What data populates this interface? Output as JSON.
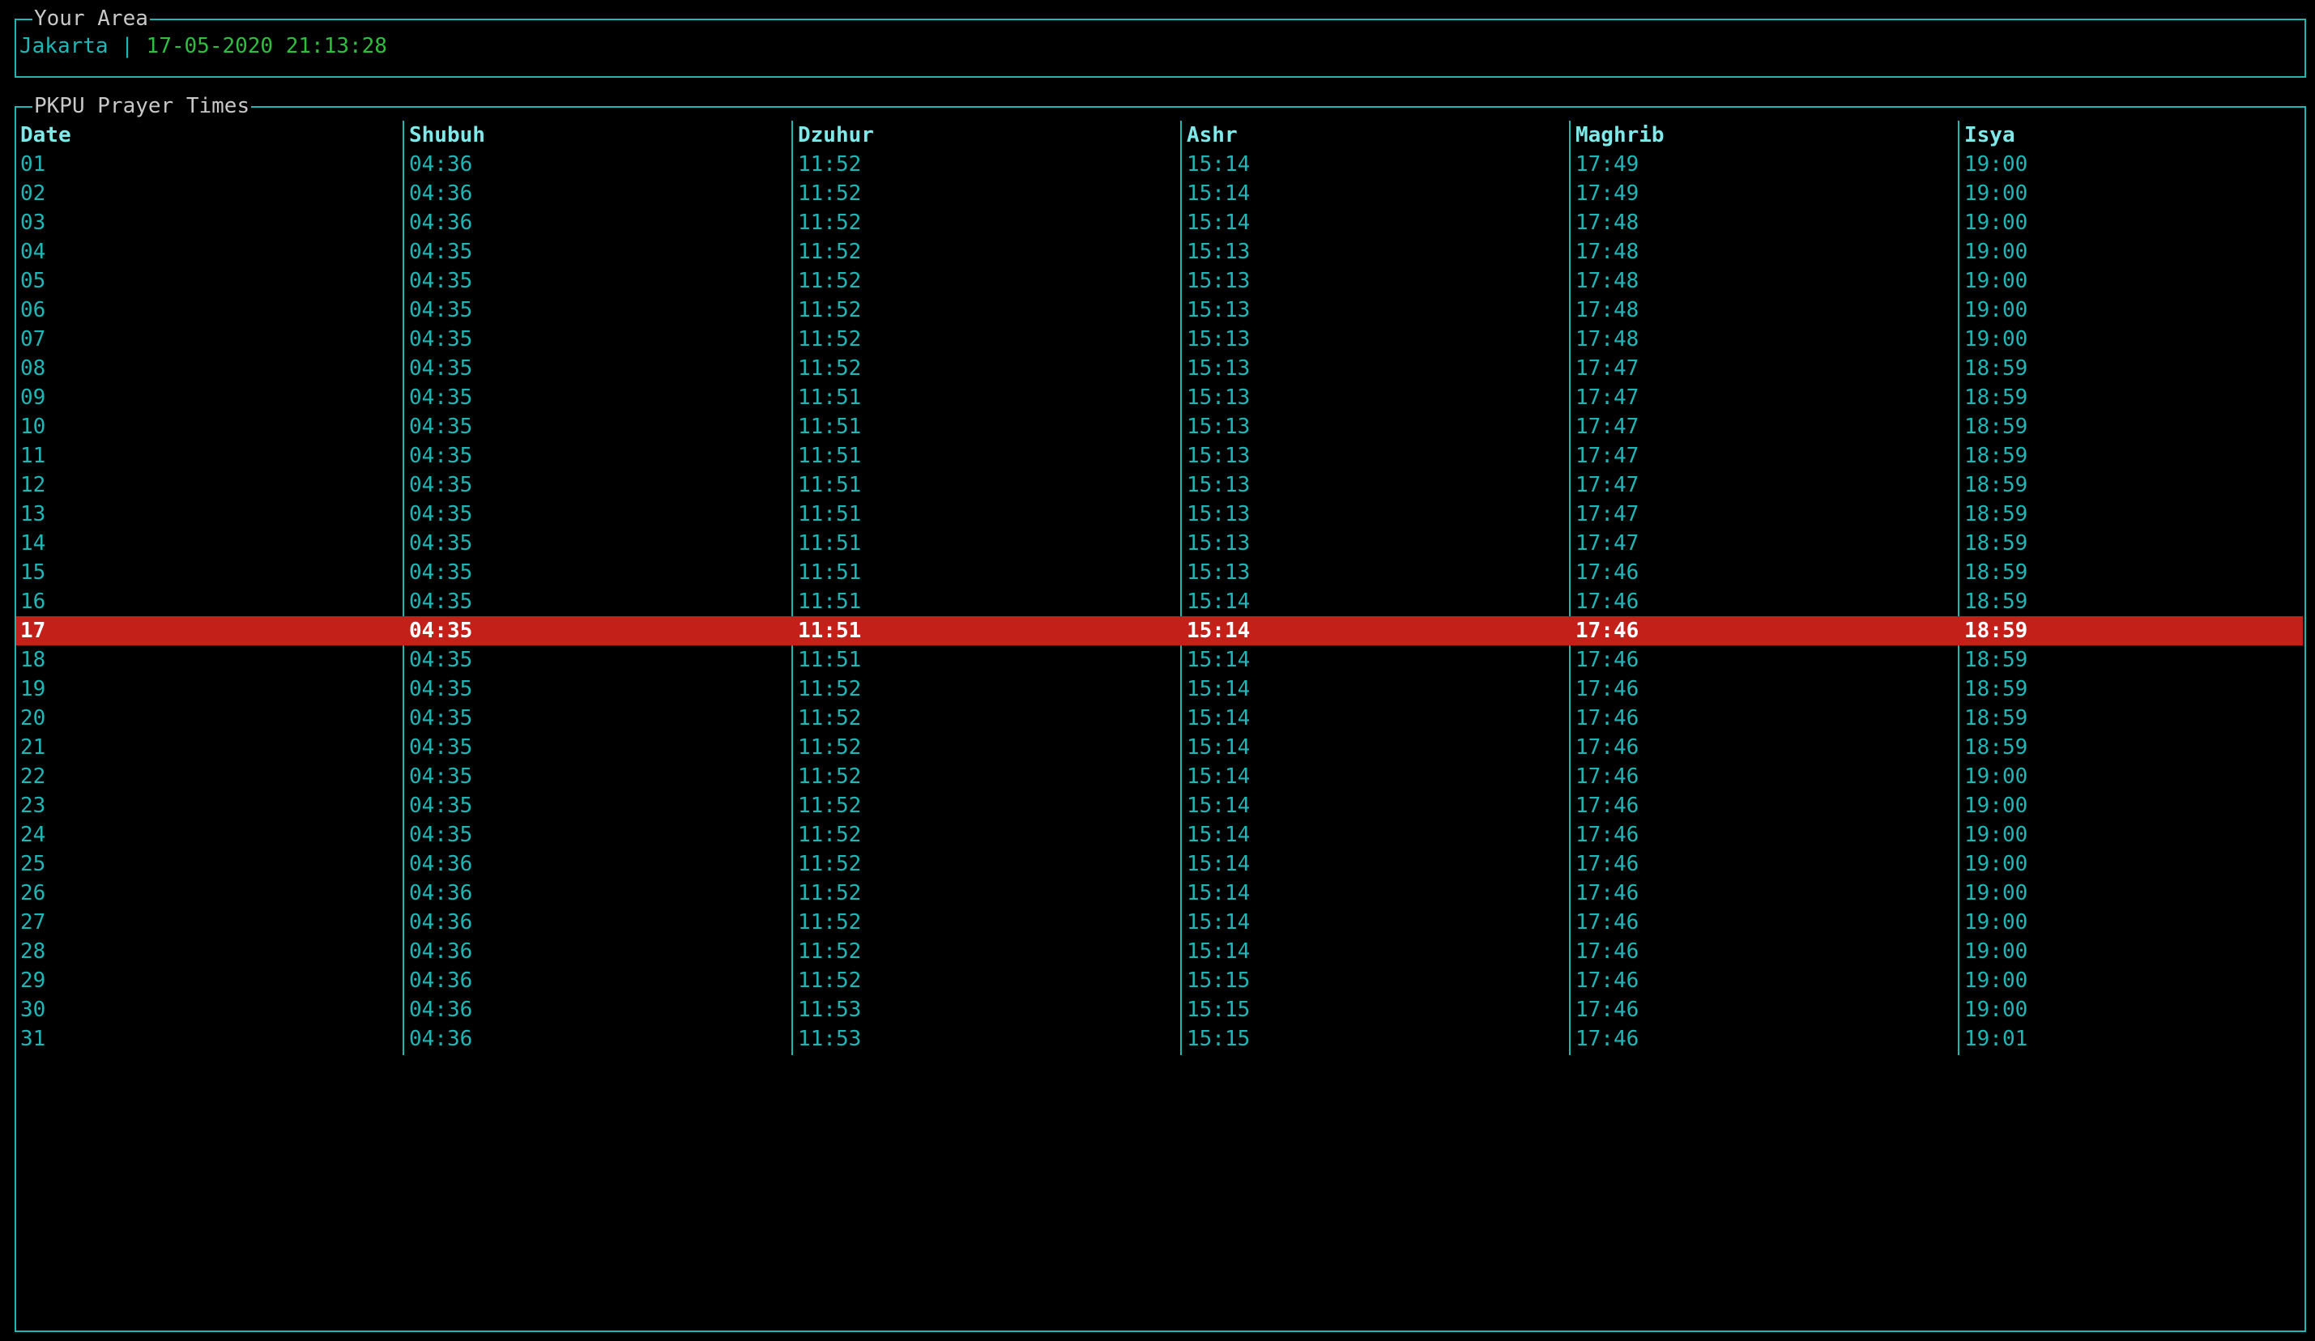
{
  "area_panel": {
    "title": "Your Area",
    "city": "Jakarta",
    "separator": " | ",
    "datetime": "17-05-2020 21:13:28"
  },
  "prayer_panel": {
    "title": "PKPU Prayer Times",
    "columns": [
      "Date",
      "Shubuh",
      "Dzuhur",
      "Ashr",
      "Maghrib",
      "Isya"
    ],
    "highlighted_date": "17",
    "colors": {
      "border": "#20b6b6",
      "text": "#20b6b6",
      "header": "#7fe9e9",
      "highlight_bg": "#c4201a",
      "highlight_text": "#ffffff",
      "datetime": "#2fbf3f"
    },
    "rows": [
      [
        "01",
        "04:36",
        "11:52",
        "15:14",
        "17:49",
        "19:00"
      ],
      [
        "02",
        "04:36",
        "11:52",
        "15:14",
        "17:49",
        "19:00"
      ],
      [
        "03",
        "04:36",
        "11:52",
        "15:14",
        "17:48",
        "19:00"
      ],
      [
        "04",
        "04:35",
        "11:52",
        "15:13",
        "17:48",
        "19:00"
      ],
      [
        "05",
        "04:35",
        "11:52",
        "15:13",
        "17:48",
        "19:00"
      ],
      [
        "06",
        "04:35",
        "11:52",
        "15:13",
        "17:48",
        "19:00"
      ],
      [
        "07",
        "04:35",
        "11:52",
        "15:13",
        "17:48",
        "19:00"
      ],
      [
        "08",
        "04:35",
        "11:52",
        "15:13",
        "17:47",
        "18:59"
      ],
      [
        "09",
        "04:35",
        "11:51",
        "15:13",
        "17:47",
        "18:59"
      ],
      [
        "10",
        "04:35",
        "11:51",
        "15:13",
        "17:47",
        "18:59"
      ],
      [
        "11",
        "04:35",
        "11:51",
        "15:13",
        "17:47",
        "18:59"
      ],
      [
        "12",
        "04:35",
        "11:51",
        "15:13",
        "17:47",
        "18:59"
      ],
      [
        "13",
        "04:35",
        "11:51",
        "15:13",
        "17:47",
        "18:59"
      ],
      [
        "14",
        "04:35",
        "11:51",
        "15:13",
        "17:47",
        "18:59"
      ],
      [
        "15",
        "04:35",
        "11:51",
        "15:13",
        "17:46",
        "18:59"
      ],
      [
        "16",
        "04:35",
        "11:51",
        "15:14",
        "17:46",
        "18:59"
      ],
      [
        "17",
        "04:35",
        "11:51",
        "15:14",
        "17:46",
        "18:59"
      ],
      [
        "18",
        "04:35",
        "11:51",
        "15:14",
        "17:46",
        "18:59"
      ],
      [
        "19",
        "04:35",
        "11:52",
        "15:14",
        "17:46",
        "18:59"
      ],
      [
        "20",
        "04:35",
        "11:52",
        "15:14",
        "17:46",
        "18:59"
      ],
      [
        "21",
        "04:35",
        "11:52",
        "15:14",
        "17:46",
        "18:59"
      ],
      [
        "22",
        "04:35",
        "11:52",
        "15:14",
        "17:46",
        "19:00"
      ],
      [
        "23",
        "04:35",
        "11:52",
        "15:14",
        "17:46",
        "19:00"
      ],
      [
        "24",
        "04:35",
        "11:52",
        "15:14",
        "17:46",
        "19:00"
      ],
      [
        "25",
        "04:36",
        "11:52",
        "15:14",
        "17:46",
        "19:00"
      ],
      [
        "26",
        "04:36",
        "11:52",
        "15:14",
        "17:46",
        "19:00"
      ],
      [
        "27",
        "04:36",
        "11:52",
        "15:14",
        "17:46",
        "19:00"
      ],
      [
        "28",
        "04:36",
        "11:52",
        "15:14",
        "17:46",
        "19:00"
      ],
      [
        "29",
        "04:36",
        "11:52",
        "15:15",
        "17:46",
        "19:00"
      ],
      [
        "30",
        "04:36",
        "11:53",
        "15:15",
        "17:46",
        "19:00"
      ],
      [
        "31",
        "04:36",
        "11:53",
        "15:15",
        "17:46",
        "19:01"
      ]
    ]
  }
}
